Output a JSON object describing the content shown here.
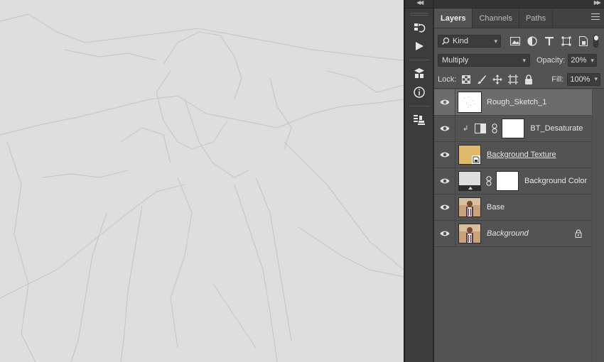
{
  "panel": {
    "tabs": [
      {
        "label": "Layers",
        "active": true
      },
      {
        "label": "Channels",
        "active": false
      },
      {
        "label": "Paths",
        "active": false
      }
    ],
    "filter": {
      "kind_label": "Kind",
      "icons": [
        "image-filter-icon",
        "adjustment-filter-icon",
        "type-filter-icon",
        "shape-filter-icon",
        "smart-object-filter-icon"
      ]
    },
    "blend": {
      "mode": "Multiply",
      "opacity_label": "Opacity:",
      "opacity_value": "20%"
    },
    "lock": {
      "label": "Lock:",
      "fill_label": "Fill:",
      "fill_value": "100%"
    }
  },
  "layers": [
    {
      "name": "Rough_Sketch_1",
      "selected": true,
      "type": "sketch"
    },
    {
      "name": "BT_Desaturate",
      "selected": false,
      "type": "adjustment"
    },
    {
      "name": "Background Texture",
      "selected": false,
      "type": "texture"
    },
    {
      "name": "Background Color",
      "selected": false,
      "type": "fill"
    },
    {
      "name": "Base",
      "selected": false,
      "type": "photo"
    },
    {
      "name": "Background",
      "selected": false,
      "type": "photo-locked"
    }
  ],
  "colors": {
    "canvas": "#dedede",
    "panel": "#535353",
    "selected_layer": "#6c6c6c",
    "texture_swatch": "#e0ba6a"
  }
}
